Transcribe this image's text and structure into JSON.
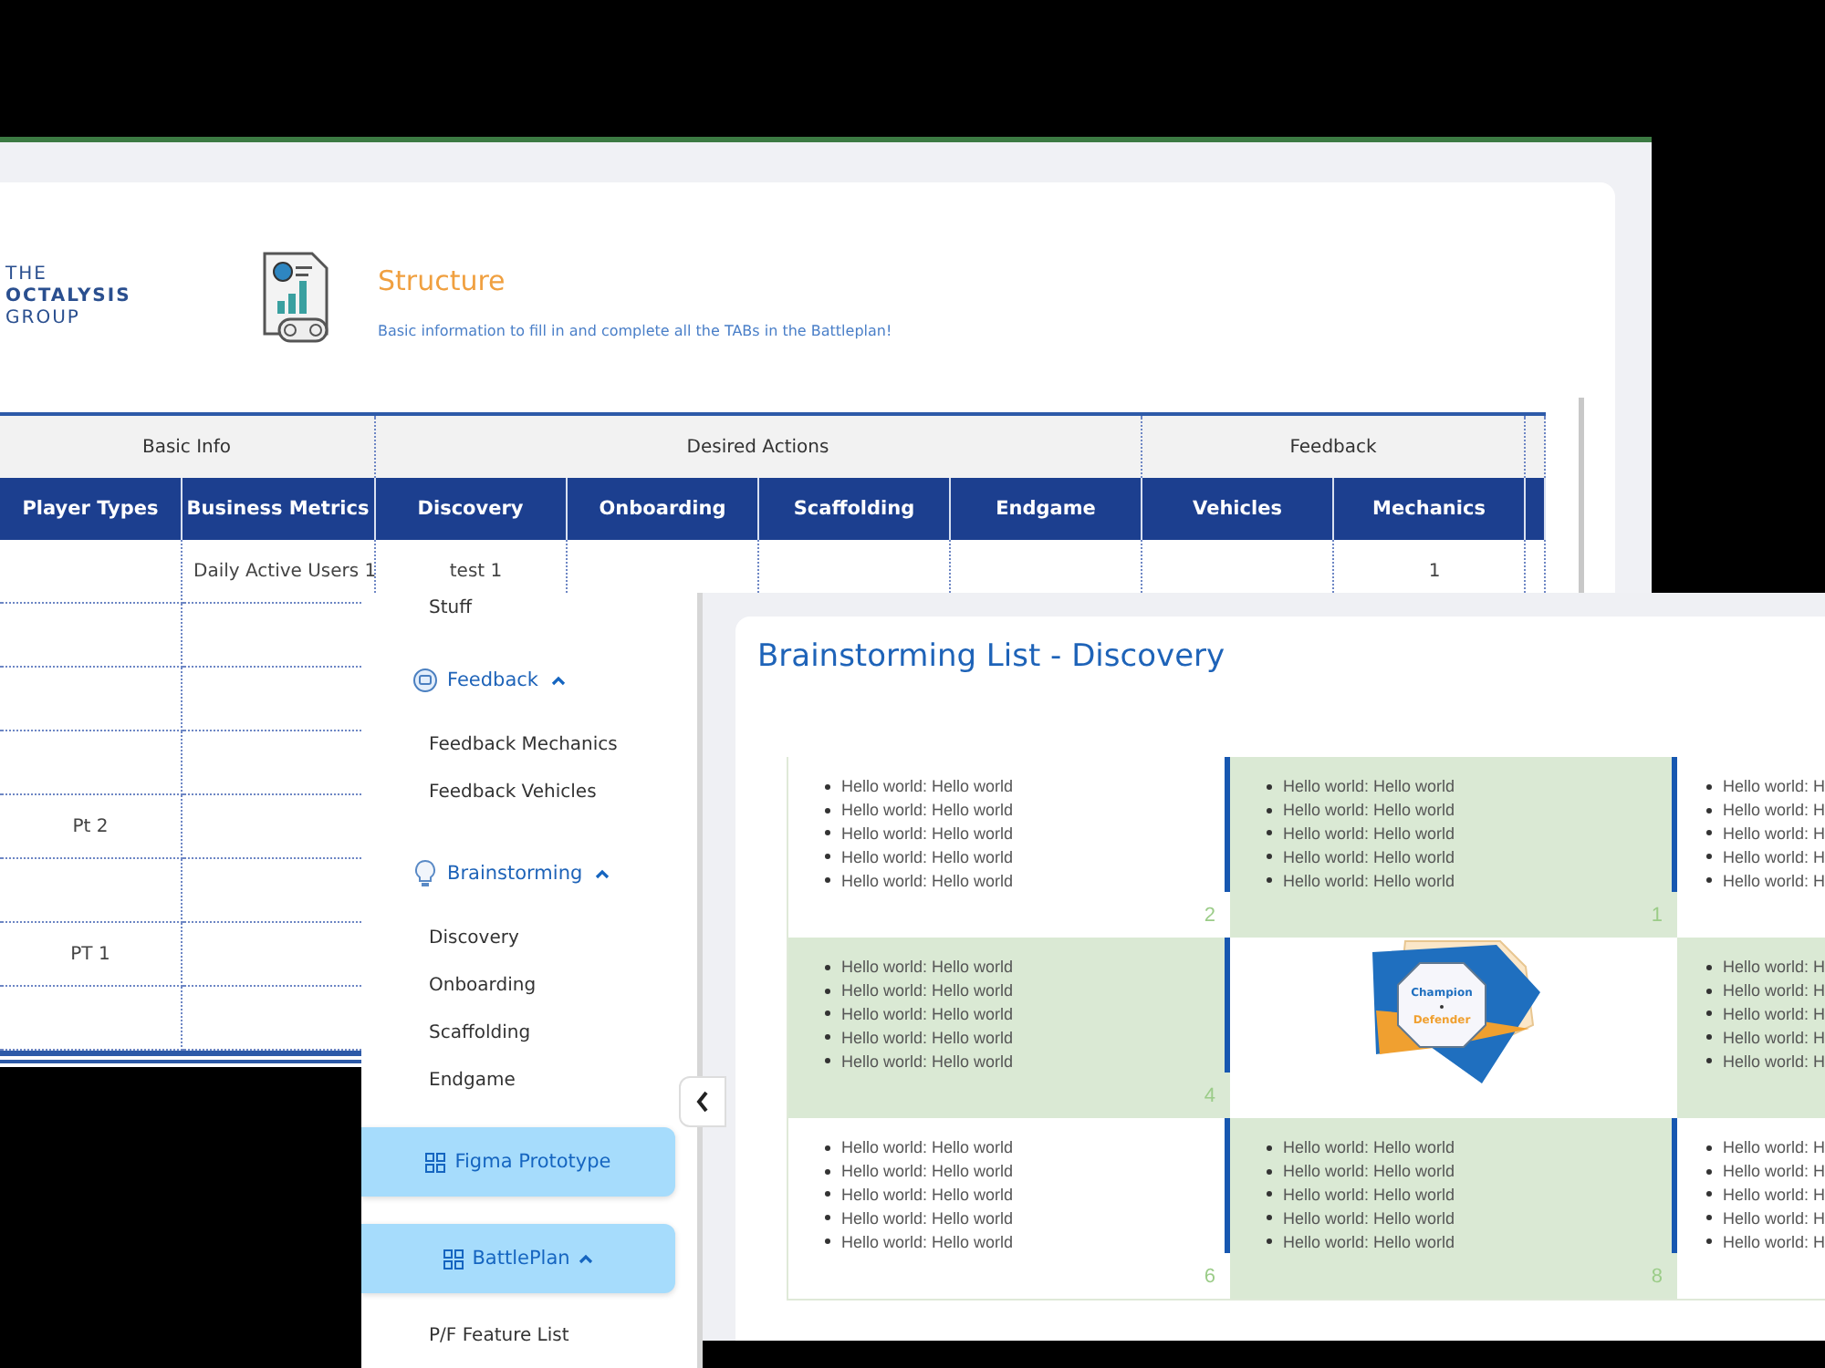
{
  "structure_window": {
    "logo": {
      "lines": [
        {
          "text": "THE",
          "bold": false
        },
        {
          "text": "OCTALYSIS",
          "bold": true
        },
        {
          "text": "GROUP",
          "bold": false
        }
      ]
    },
    "header": {
      "title": "Structure",
      "subtitle": "Basic information to fill in and complete all the TABs in the Battleplan!"
    },
    "table": {
      "groups": [
        {
          "label": "Basic Info",
          "columns": [
            "Player Types",
            "Business Metrics"
          ]
        },
        {
          "label": "Desired Actions",
          "columns": [
            "Discovery",
            "Onboarding",
            "Scaffolding",
            "Endgame"
          ]
        },
        {
          "label": "Feedback",
          "columns": [
            "Vehicles",
            "Mechanics"
          ]
        }
      ],
      "rows": [
        {
          "cells": [
            null,
            "Daily Active Users 1",
            "test 1",
            null,
            null,
            null,
            null,
            "1"
          ]
        },
        {
          "cells": [
            null,
            null
          ]
        },
        {
          "cells": [
            null,
            null
          ]
        },
        {
          "cells": [
            null,
            null
          ]
        },
        {
          "cells": [
            "Pt 2",
            null
          ]
        },
        {
          "cells": [
            null,
            null
          ]
        },
        {
          "cells": [
            "PT 1",
            null
          ]
        },
        {
          "cells": [
            null,
            null
          ]
        }
      ]
    }
  },
  "sidebar": {
    "items": [
      {
        "kind": "item",
        "label": "Stuff"
      },
      {
        "kind": "group",
        "label": "Feedback",
        "expanded": true,
        "children": [
          {
            "label": "Feedback Mechanics"
          },
          {
            "label": "Feedback Vehicles"
          }
        ]
      },
      {
        "kind": "group",
        "label": "Brainstorming",
        "expanded": true,
        "children": [
          {
            "label": "Discovery"
          },
          {
            "label": "Onboarding"
          },
          {
            "label": "Scaffolding"
          },
          {
            "label": "Endgame"
          }
        ]
      },
      {
        "kind": "button",
        "label": "Figma Prototype"
      },
      {
        "kind": "button",
        "label": "BattlePlan",
        "expanded": true,
        "children": [
          {
            "label": "P/F Feature List"
          }
        ]
      }
    ]
  },
  "brainstorming": {
    "title": "Brainstorming List - Discovery",
    "cells": [
      {
        "kind": "list",
        "highlighted": false,
        "accent": true,
        "number": "2",
        "items": [
          "Hello world: Hello world",
          "Hello world: Hello world",
          "Hello world: Hello world",
          "Hello world: Hello world",
          "Hello world: Hello world"
        ]
      },
      {
        "kind": "list",
        "highlighted": true,
        "accent": true,
        "number": "1",
        "items": [
          "Hello world: Hello world",
          "Hello world: Hello world",
          "Hello world: Hello world",
          "Hello world: Hello world",
          "Hello world: Hello world"
        ]
      },
      {
        "kind": "list",
        "highlighted": false,
        "accent": false,
        "items": [
          "Hello world: H",
          "Hello world: H",
          "Hello world: H",
          "Hello world: H",
          "Hello world: H"
        ]
      },
      {
        "kind": "list",
        "highlighted": true,
        "accent": true,
        "number": "4",
        "items": [
          "Hello world: Hello world",
          "Hello world: Hello world",
          "Hello world: Hello world",
          "Hello world: Hello world",
          "Hello world: Hello world"
        ]
      },
      {
        "kind": "logo",
        "highlighted": false,
        "accent": false,
        "lines": [
          "Champion",
          "Defender"
        ]
      },
      {
        "kind": "list",
        "highlighted": true,
        "accent": false,
        "items": [
          "Hello world: H",
          "Hello world: H",
          "Hello world: H",
          "Hello world: H",
          "Hello world: H"
        ]
      },
      {
        "kind": "list",
        "highlighted": false,
        "accent": true,
        "number": "6",
        "items": [
          "Hello world: Hello world",
          "Hello world: Hello world",
          "Hello world: Hello world",
          "Hello world: Hello world",
          "Hello world: Hello world"
        ]
      },
      {
        "kind": "list",
        "highlighted": true,
        "accent": true,
        "number": "8",
        "items": [
          "Hello world: Hello world",
          "Hello world: Hello world",
          "Hello world: Hello world",
          "Hello world: Hello world",
          "Hello world: Hello world"
        ]
      },
      {
        "kind": "list",
        "highlighted": false,
        "accent": false,
        "items": [
          "Hello world: H",
          "Hello world: H",
          "Hello world: H",
          "Hello world: H",
          "Hello world: H"
        ]
      }
    ]
  }
}
